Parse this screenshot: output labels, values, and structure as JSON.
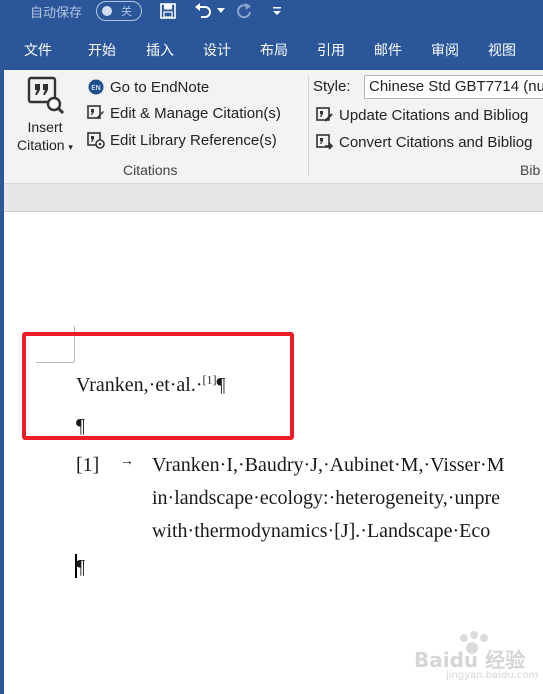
{
  "titlebar": {
    "autosave_label": "自动保存",
    "autosave_state": "关"
  },
  "tabs": [
    "文件",
    "开始",
    "插入",
    "设计",
    "布局",
    "引用",
    "邮件",
    "审阅",
    "视图"
  ],
  "citations_group": {
    "insert_citation_line1": "Insert",
    "insert_citation_line2": "Citation",
    "go_to_endnote": "Go to EndNote",
    "edit_manage": "Edit & Manage Citation(s)",
    "edit_library": "Edit Library Reference(s)",
    "label": "Citations"
  },
  "bibliography_group": {
    "style_label": "Style:",
    "style_value": "Chinese Std GBT7714 (nu",
    "update_citations": "Update Citations and Bibliog",
    "convert_citations": "Convert Citations and Bibliog",
    "label": "Bib"
  },
  "document": {
    "citation_text": "Vranken,·et·al.·",
    "citation_ref": "[1]",
    "pilcrow": "¶",
    "ref_number": "[1]",
    "ref_arrow": "→",
    "ref_line1": "Vranken·I,·Baudry·J,·Aubinet·M,·Visser·M",
    "ref_line2": "in·landscape·ecology:·heterogeneity,·unpre",
    "ref_line3": "with·thermodynamics·[J].·Landscape·Eco"
  },
  "watermark": {
    "brand": "Baidu 经验",
    "url": "jingyan.baidu.com"
  },
  "colors": {
    "ribbon_blue": "#2b579a",
    "highlight_red": "#ee1c25"
  }
}
